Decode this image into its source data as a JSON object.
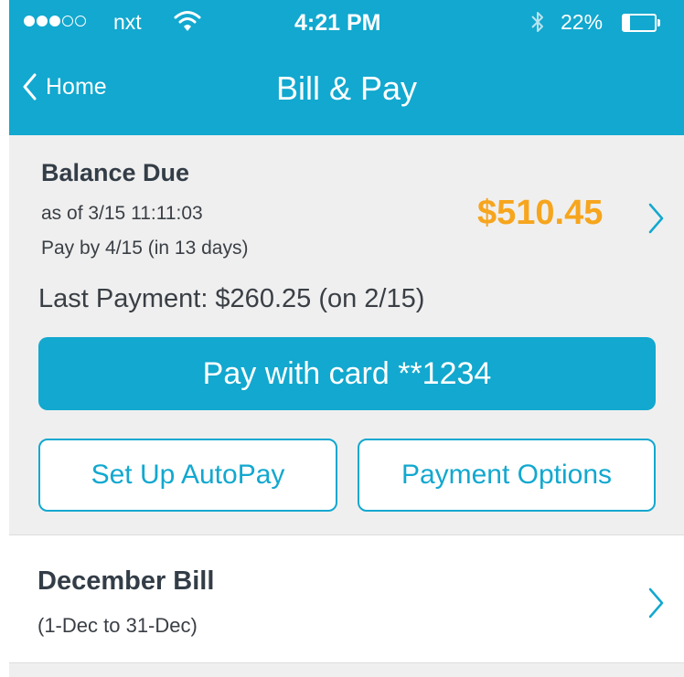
{
  "status_bar": {
    "signal_filled": 3,
    "signal_total": 5,
    "carrier": "nxt",
    "time": "4:21 PM",
    "battery": "22%",
    "battery_level": 0.22
  },
  "nav": {
    "back_label": "Home",
    "title": "Bill & Pay"
  },
  "balance": {
    "title": "Balance Due",
    "as_of": "as of 3/15 11:11:03",
    "pay_by": "Pay by 4/15 (in 13 days)",
    "amount": "$510.45",
    "last_payment": "Last Payment: $260.25 (on 2/15)"
  },
  "actions": {
    "pay_button": "Pay with card **1234",
    "autopay_button": "Set Up AutoPay",
    "options_button": "Payment Options"
  },
  "bill": {
    "title": "December Bill",
    "range": "(1-Dec to 31-Dec)"
  },
  "colors": {
    "accent": "#12a8cf",
    "amount": "#f6a51d"
  }
}
